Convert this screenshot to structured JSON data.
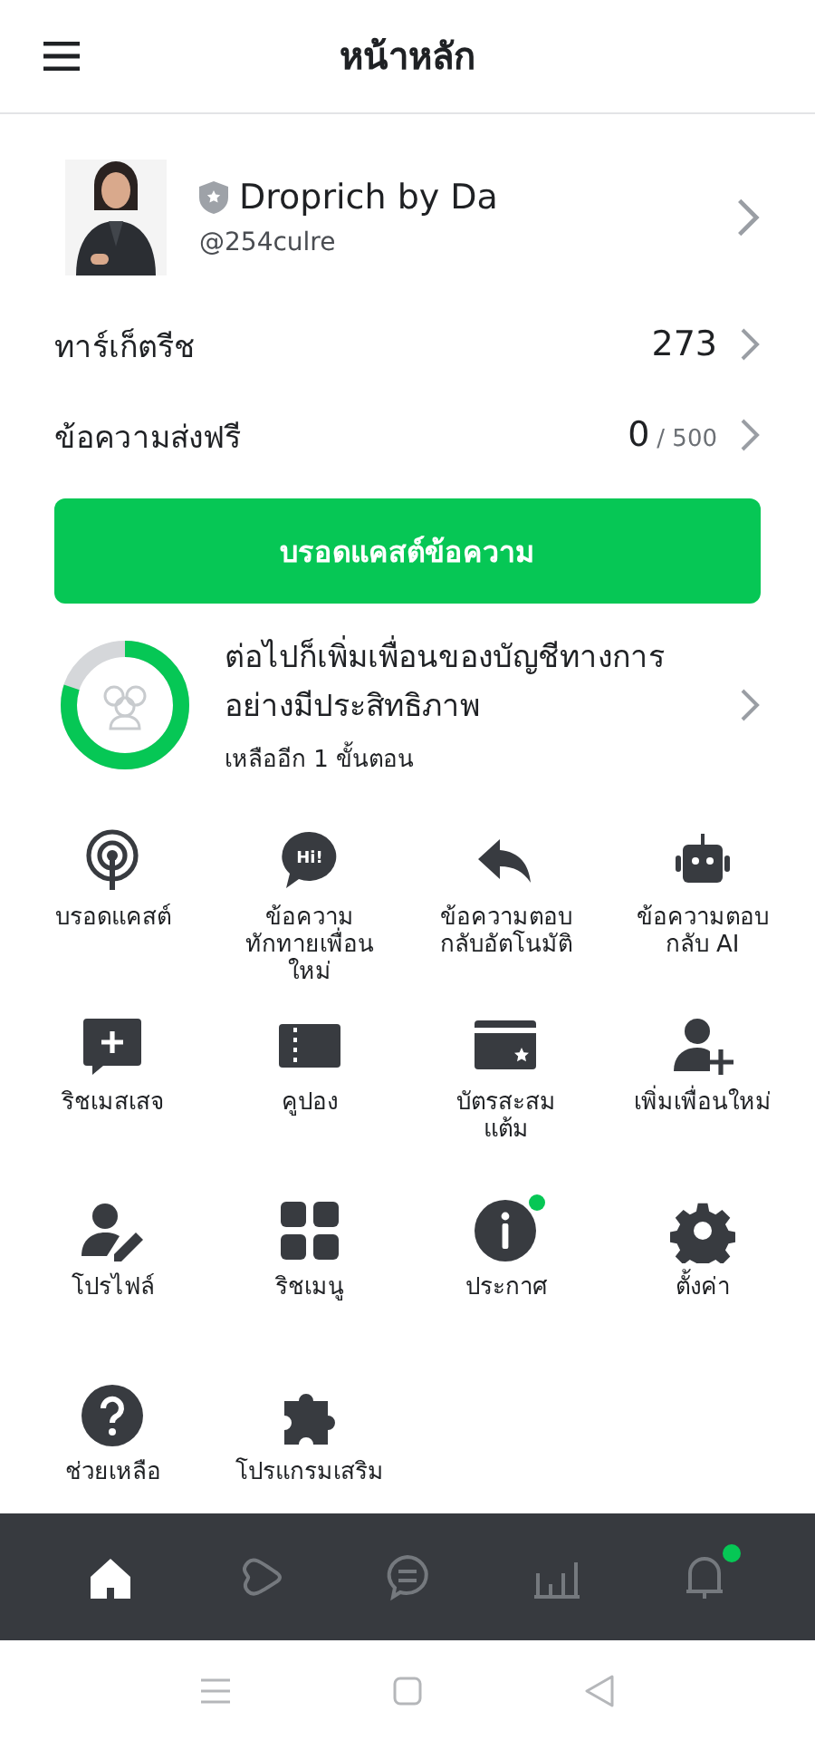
{
  "header": {
    "title": "หน้าหลัก"
  },
  "profile": {
    "name": "Droprich by Da",
    "handle": "@254culre"
  },
  "stats": [
    {
      "label": "ทาร์เก็ตรีช",
      "value": "273"
    },
    {
      "label": "ข้อความส่งฟรี",
      "value": "0",
      "limit": "/ 500"
    }
  ],
  "broadcast_button": "บรอดแคสต์ข้อความ",
  "progress": {
    "level": 0.8,
    "title": "ต่อไปก็เพิ่มเพื่อนของบัญชีทางการอย่างมีประสิทธิภาพ",
    "subtitle": "เหลืออีก 1 ขั้นตอน"
  },
  "features": [
    {
      "label": "บรอดแคสต์",
      "badge": false
    },
    {
      "label": "ข้อความทักทายเพื่อนใหม่",
      "badge": false,
      "icon_text": "Hi!"
    },
    {
      "label": "ข้อความตอบกลับอัตโนมัติ",
      "badge": false
    },
    {
      "label": "ข้อความตอบกลับ AI",
      "badge": false
    },
    {
      "label": "ริชเมสเสจ",
      "badge": false
    },
    {
      "label": "คูปอง",
      "badge": false
    },
    {
      "label": "บัตรสะสมแต้ม",
      "badge": false
    },
    {
      "label": "เพิ่มเพื่อนใหม่",
      "badge": false
    },
    {
      "label": "โปรไฟล์",
      "badge": false
    },
    {
      "label": "ริชเมนู",
      "badge": false
    },
    {
      "label": "ประกาศ",
      "badge": true
    },
    {
      "label": "ตั้งค่า",
      "badge": false
    },
    {
      "label": "ช่วยเหลือ",
      "badge": false
    },
    {
      "label": "โปรแกรมเสริม",
      "badge": false
    }
  ],
  "bottom_nav": [
    {
      "selected": true,
      "badge": false
    },
    {
      "selected": false,
      "badge": false
    },
    {
      "selected": false,
      "badge": false
    },
    {
      "selected": false,
      "badge": false
    },
    {
      "selected": false,
      "badge": true
    }
  ]
}
